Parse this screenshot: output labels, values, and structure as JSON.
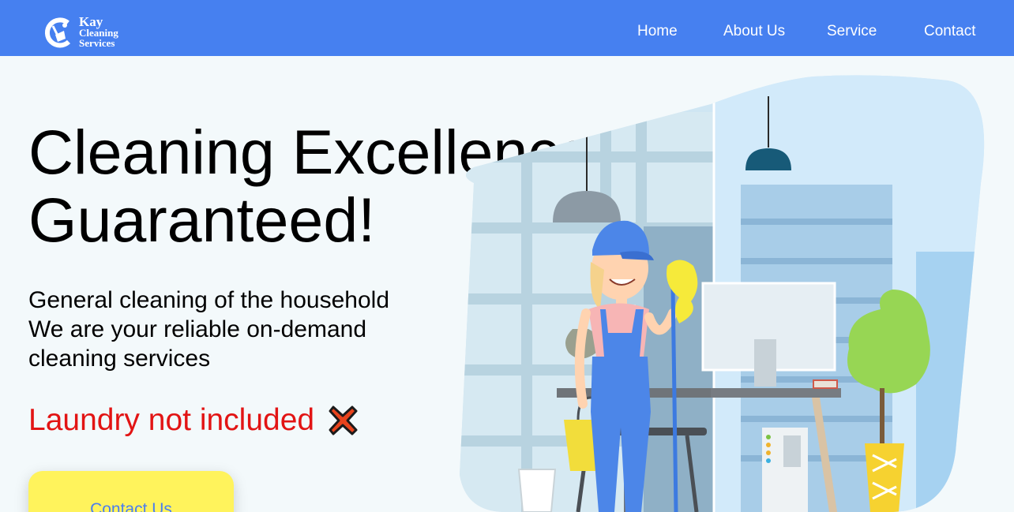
{
  "brand": {
    "line1": "Kay",
    "line2": "Cleaning",
    "line3": "Services"
  },
  "nav": {
    "home": "Home",
    "about": "About Us",
    "service": "Service",
    "contact": "Contact"
  },
  "hero": {
    "title_line1": "Cleaning Excellence",
    "title_line2": "Guaranteed!",
    "sub_line1": "General cleaning of the household",
    "sub_line2": "We are your reliable on-demand",
    "sub_line3": "cleaning services",
    "notice": "Laundry not included",
    "cta_label": "Contact Us"
  },
  "colors": {
    "navbar": "#4680f0",
    "page_bg": "#f3f9fb",
    "notice": "#e21414",
    "cta_bg": "#fff35c",
    "cta_text": "#4a7ef0"
  },
  "icons": {
    "logo": "broom-logo-icon",
    "notice": "red-cross-mark-icon"
  }
}
